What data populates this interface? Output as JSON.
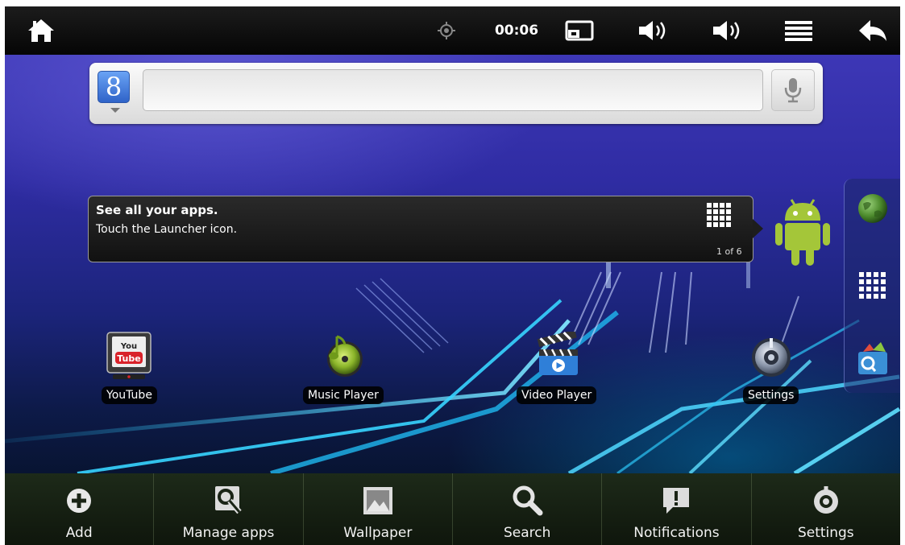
{
  "status_bar": {
    "clock": "00:06",
    "icons": [
      "home-icon",
      "location-icon",
      "screen-rotate-icon",
      "volume-down-icon",
      "volume-up-icon",
      "menu-icon",
      "back-icon"
    ]
  },
  "search_widget": {
    "logo_letter": "8",
    "query": "",
    "icons": [
      "google-logo-icon",
      "microphone-icon"
    ]
  },
  "hint": {
    "title": "See all your apps.",
    "body": "Touch the Launcher icon.",
    "page_indicator": "1 of 6"
  },
  "dock": {
    "icons": [
      "browser-globe-icon",
      "launcher-grid-icon",
      "app-store-icon"
    ]
  },
  "desktop_apps": [
    {
      "label": "YouTube",
      "icon": "youtube-icon"
    },
    {
      "label": "Music Player",
      "icon": "music-player-icon"
    },
    {
      "label": "Video Player",
      "icon": "video-player-icon"
    },
    {
      "label": "Settings",
      "icon": "settings-icon"
    }
  ],
  "youtube_icon_text": {
    "top": "You",
    "bottom": "Tube"
  },
  "options_menu": [
    {
      "label": "Add",
      "icon": "add-icon"
    },
    {
      "label": "Manage apps",
      "icon": "manage-apps-icon"
    },
    {
      "label": "Wallpaper",
      "icon": "wallpaper-icon"
    },
    {
      "label": "Search",
      "icon": "search-icon"
    },
    {
      "label": "Notifications",
      "icon": "notifications-icon"
    },
    {
      "label": "Settings",
      "icon": "settings-icon"
    }
  ],
  "colors": {
    "android_green": "#a4c639",
    "wallpaper_blue": "#2f2ca3",
    "streak_cyan": "#22c8ff"
  }
}
